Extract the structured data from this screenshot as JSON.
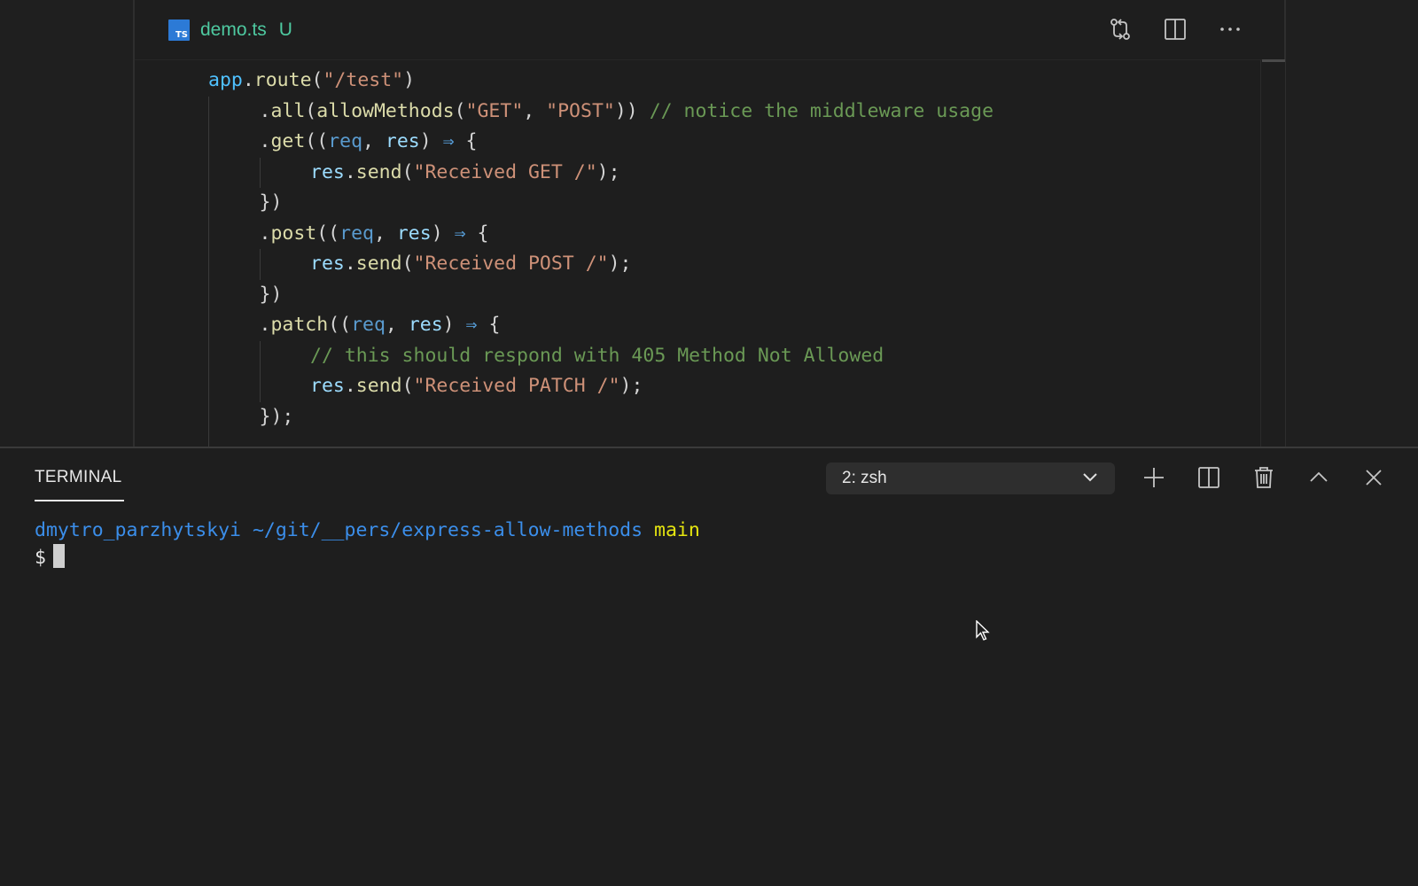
{
  "editor": {
    "tab": {
      "badge": "TS",
      "filename": "demo.ts",
      "status": "U"
    },
    "actions": [
      "open-changes-icon",
      "split-editor-icon",
      "more-actions-icon"
    ],
    "code_lines": [
      [
        {
          "t": "app",
          "c": "obj"
        },
        {
          "t": ".",
          "c": "punc"
        },
        {
          "t": "route",
          "c": "fn"
        },
        {
          "t": "(",
          "c": "punc"
        },
        {
          "t": "\"/test\"",
          "c": "str"
        },
        {
          "t": ")",
          "c": "punc"
        }
      ],
      [
        {
          "t": ".",
          "c": "punc"
        },
        {
          "t": "all",
          "c": "fn"
        },
        {
          "t": "(",
          "c": "punc"
        },
        {
          "t": "allowMethods",
          "c": "fn"
        },
        {
          "t": "(",
          "c": "punc"
        },
        {
          "t": "\"GET\"",
          "c": "str"
        },
        {
          "t": ", ",
          "c": "punc"
        },
        {
          "t": "\"POST\"",
          "c": "str"
        },
        {
          "t": ")) ",
          "c": "punc"
        },
        {
          "t": "// notice the middleware usage",
          "c": "com"
        }
      ],
      [
        {
          "t": ".",
          "c": "punc"
        },
        {
          "t": "get",
          "c": "fn"
        },
        {
          "t": "((",
          "c": "punc"
        },
        {
          "t": "req",
          "c": "param"
        },
        {
          "t": ", ",
          "c": "punc"
        },
        {
          "t": "res",
          "c": "var"
        },
        {
          "t": ") ",
          "c": "punc"
        },
        {
          "t": "⇒",
          "c": "arrow"
        },
        {
          "t": " {",
          "c": "punc"
        }
      ],
      [
        {
          "t": "res",
          "c": "var"
        },
        {
          "t": ".",
          "c": "punc"
        },
        {
          "t": "send",
          "c": "fn"
        },
        {
          "t": "(",
          "c": "punc"
        },
        {
          "t": "\"Received GET /\"",
          "c": "str"
        },
        {
          "t": ");",
          "c": "punc"
        }
      ],
      [
        {
          "t": "})",
          "c": "punc"
        }
      ],
      [
        {
          "t": ".",
          "c": "punc"
        },
        {
          "t": "post",
          "c": "fn"
        },
        {
          "t": "((",
          "c": "punc"
        },
        {
          "t": "req",
          "c": "param"
        },
        {
          "t": ", ",
          "c": "punc"
        },
        {
          "t": "res",
          "c": "var"
        },
        {
          "t": ") ",
          "c": "punc"
        },
        {
          "t": "⇒",
          "c": "arrow"
        },
        {
          "t": " {",
          "c": "punc"
        }
      ],
      [
        {
          "t": "res",
          "c": "var"
        },
        {
          "t": ".",
          "c": "punc"
        },
        {
          "t": "send",
          "c": "fn"
        },
        {
          "t": "(",
          "c": "punc"
        },
        {
          "t": "\"Received POST /\"",
          "c": "str"
        },
        {
          "t": ");",
          "c": "punc"
        }
      ],
      [
        {
          "t": "})",
          "c": "punc"
        }
      ],
      [
        {
          "t": ".",
          "c": "punc"
        },
        {
          "t": "patch",
          "c": "fn"
        },
        {
          "t": "((",
          "c": "punc"
        },
        {
          "t": "req",
          "c": "param"
        },
        {
          "t": ", ",
          "c": "punc"
        },
        {
          "t": "res",
          "c": "var"
        },
        {
          "t": ") ",
          "c": "punc"
        },
        {
          "t": "⇒",
          "c": "arrow"
        },
        {
          "t": " {",
          "c": "punc"
        }
      ],
      [
        {
          "t": "// this should respond with 405 Method Not Allowed",
          "c": "com"
        }
      ],
      [
        {
          "t": "res",
          "c": "var"
        },
        {
          "t": ".",
          "c": "punc"
        },
        {
          "t": "send",
          "c": "fn"
        },
        {
          "t": "(",
          "c": "punc"
        },
        {
          "t": "\"Received PATCH /\"",
          "c": "str"
        },
        {
          "t": ");",
          "c": "punc"
        }
      ],
      [
        {
          "t": "});",
          "c": "punc"
        }
      ]
    ],
    "code_indent_levels": [
      0,
      1,
      1,
      2,
      1,
      1,
      2,
      1,
      1,
      2,
      2,
      1
    ]
  },
  "panel": {
    "tab_label": "TERMINAL",
    "terminal_select_value": "2: zsh",
    "actions": [
      "new-terminal-icon",
      "split-terminal-icon",
      "kill-terminal-icon",
      "maximize-panel-icon",
      "close-panel-icon"
    ]
  },
  "terminal": {
    "user": "dmytro_parzhytskyi",
    "path": "~/git/__pers/express-allow-methods",
    "branch": "main",
    "prompt": "$"
  },
  "colors": {
    "background": "#1e1e1e",
    "string": "#ce9178",
    "comment": "#6a9955",
    "function": "#dcdcaa",
    "variable": "#9cdcfe",
    "git_added": "#4ec9a0",
    "terminal_blue": "#3b8eea",
    "terminal_yellow": "#e5e510"
  }
}
